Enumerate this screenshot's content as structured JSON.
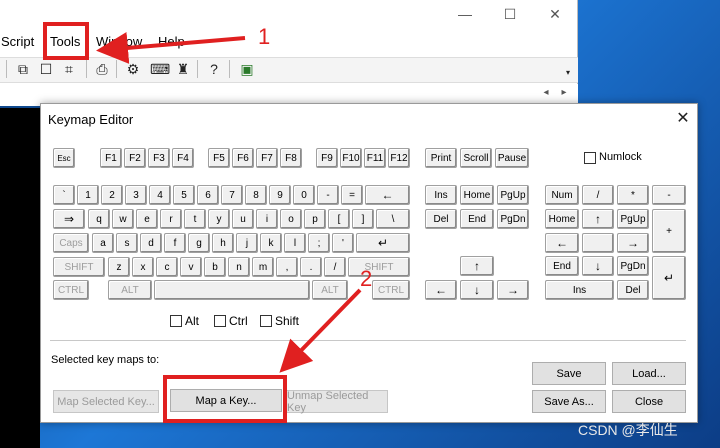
{
  "app": {
    "menu": [
      "Script",
      "Tools",
      "Window",
      "Help"
    ],
    "caption_buttons": [
      "—",
      "☐",
      "✕"
    ]
  },
  "toolbar_icons": [
    "copy-icon",
    "stop-icon",
    "find-icon",
    "print-icon",
    "gear-icon",
    "keyboard-icon",
    "key-icon",
    "help-icon",
    "image-icon"
  ],
  "dialog": {
    "title": "Keymap Editor",
    "close": "✕",
    "fkeys": [
      "Esc",
      "F1",
      "F2",
      "F3",
      "F4",
      "F5",
      "F6",
      "F7",
      "F8",
      "F9",
      "F10",
      "F11",
      "F12",
      "Print",
      "Scroll",
      "Pause"
    ],
    "numlock_label": "Numlock",
    "row1": [
      "`",
      "1",
      "2",
      "3",
      "4",
      "5",
      "6",
      "7",
      "8",
      "9",
      "0",
      "-",
      "=",
      "←"
    ],
    "row2": [
      "⇒",
      "q",
      "w",
      "e",
      "r",
      "t",
      "y",
      "u",
      "i",
      "o",
      "p",
      "[",
      "]",
      "\\"
    ],
    "row3": [
      "Caps",
      "a",
      "s",
      "d",
      "f",
      "g",
      "h",
      "j",
      "k",
      "l",
      ";",
      "'",
      "↵"
    ],
    "row4": [
      "SHIFT",
      "z",
      "x",
      "c",
      "v",
      "b",
      "n",
      "m",
      ",",
      ".",
      "/",
      "SHIFT"
    ],
    "row5": [
      "CTRL",
      "ALT",
      "",
      "ALT",
      "CTRL"
    ],
    "nav": [
      "Ins",
      "Home",
      "PgUp",
      "Del",
      "End",
      "PgDn"
    ],
    "arrows": [
      "↑",
      "←",
      "↓",
      "→"
    ],
    "numpad": [
      "Num",
      "/",
      "*",
      "-",
      "Home",
      "↑",
      "PgUp",
      "+",
      "←",
      "→",
      "End",
      "↓",
      "PgDn",
      "↵",
      "Ins",
      "Del"
    ],
    "modifiers": {
      "alt": "Alt",
      "ctrl": "Ctrl",
      "shift": "Shift"
    },
    "status_label": "Selected key maps to:",
    "buttons": {
      "map_selected": "Map Selected Key...",
      "map_a_key": "Map a Key...",
      "unmap_selected": "Unmap Selected Key",
      "save": "Save",
      "load": "Load...",
      "save_as": "Save As...",
      "close": "Close"
    }
  },
  "annotations": {
    "one": "1",
    "two": "2"
  },
  "watermark": "CSDN @李仙生"
}
